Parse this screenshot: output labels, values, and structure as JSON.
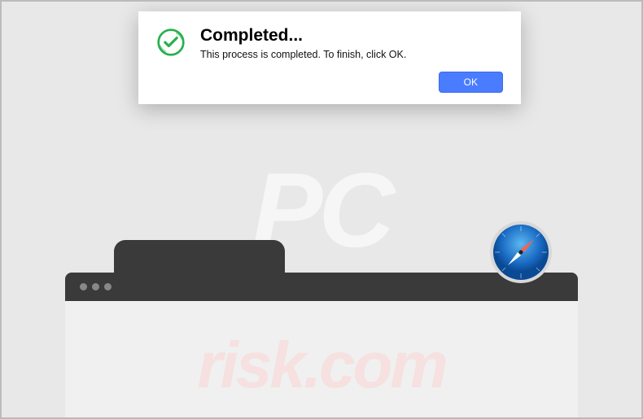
{
  "dialog": {
    "title": "Completed...",
    "message": "This process is completed. To finish, click OK.",
    "ok_label": "OK"
  },
  "watermark": {
    "main": "PC",
    "sub": "risk.com"
  }
}
